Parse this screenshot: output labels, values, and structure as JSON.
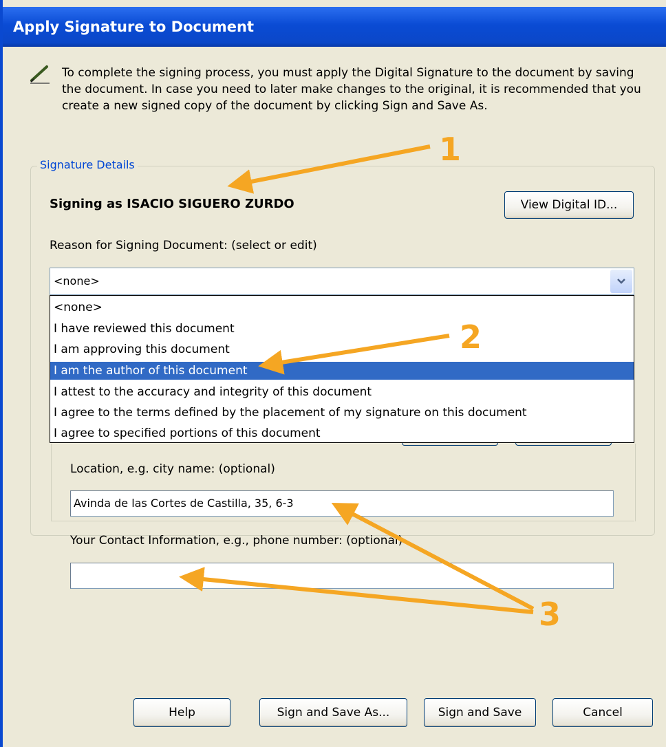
{
  "window": {
    "title": "Apply Signature to Document"
  },
  "intro": {
    "text": "To complete the signing process, you must apply the Digital Signature to the document by saving the document. In case you need to later make changes to the original, it is recommended that you create a new signed copy of the document by clicking Sign and Save As."
  },
  "details": {
    "group_title": "Signature Details",
    "signing_as": "Signing as ISACIO SIGUERO ZURDO",
    "view_digital_id_label": "View Digital ID...",
    "reason_label": "Reason for Signing Document: (select or edit)",
    "reason_value": "<none>",
    "reason_options": [
      "<none>",
      "I have reviewed this document",
      "I am approving this document",
      "I am the author of this document",
      "I attest to the accuracy and integrity of this document",
      "I agree to the terms defined by the placement of my signature on this document",
      "I agree to specified portions of this document"
    ],
    "highlighted_option": "I am the author of this document",
    "location_label": "Location, e.g. city name: (optional)",
    "location_value": "Avinda de las Cortes de Castilla, 35, 6-3",
    "contact_label": "Your Contact Information, e.g., phone number: (optional)",
    "contact_value": ""
  },
  "buttons": {
    "help": "Help",
    "sign_save_as": "Sign and Save As...",
    "sign_save": "Sign and Save",
    "cancel": "Cancel"
  },
  "annotations": {
    "one": "1",
    "two": "2",
    "three": "3",
    "color": "#f5a623"
  },
  "colors": {
    "titlebar": "#0a4bd4",
    "dialog_bg": "#ece9d8",
    "selection": "#316ac5",
    "group_title": "#0046d5"
  },
  "icons": {
    "intro": "pen-icon",
    "combo": "chevron-down-icon"
  }
}
